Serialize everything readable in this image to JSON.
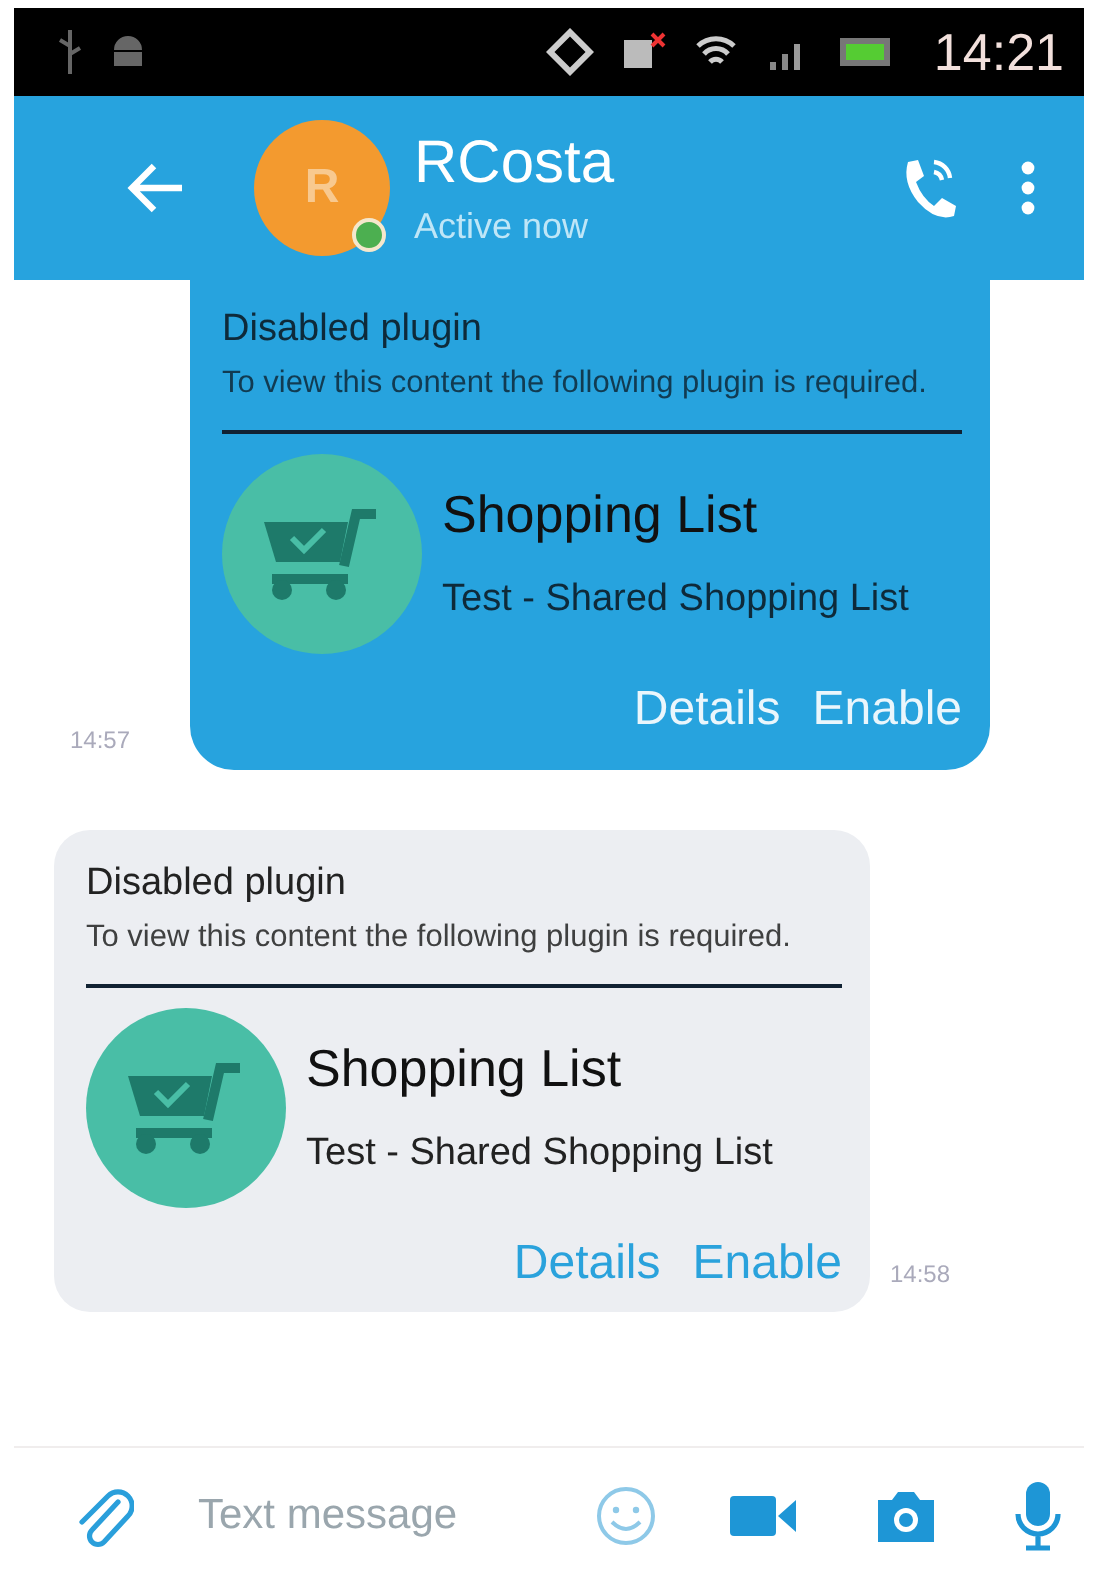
{
  "status_bar": {
    "time": "14:21"
  },
  "header": {
    "avatar_letter": "R",
    "online": true,
    "title": "RCosta",
    "subtitle": "Active now"
  },
  "messages": [
    {
      "kind": "outgoing",
      "time": "14:57",
      "title": "Disabled plugin",
      "description": "To view this content the following plugin is required.",
      "plugin_name": "Shopping List",
      "plugin_subtitle": "Test - Shared Shopping List",
      "actions": [
        "Details",
        "Enable"
      ]
    },
    {
      "kind": "incoming",
      "time": "14:58",
      "title": "Disabled plugin",
      "description": "To view this content the following plugin is required.",
      "plugin_name": "Shopping List",
      "plugin_subtitle": "Test - Shared Shopping List",
      "actions": [
        "Details",
        "Enable"
      ]
    }
  ],
  "composer": {
    "placeholder": "Text message"
  }
}
